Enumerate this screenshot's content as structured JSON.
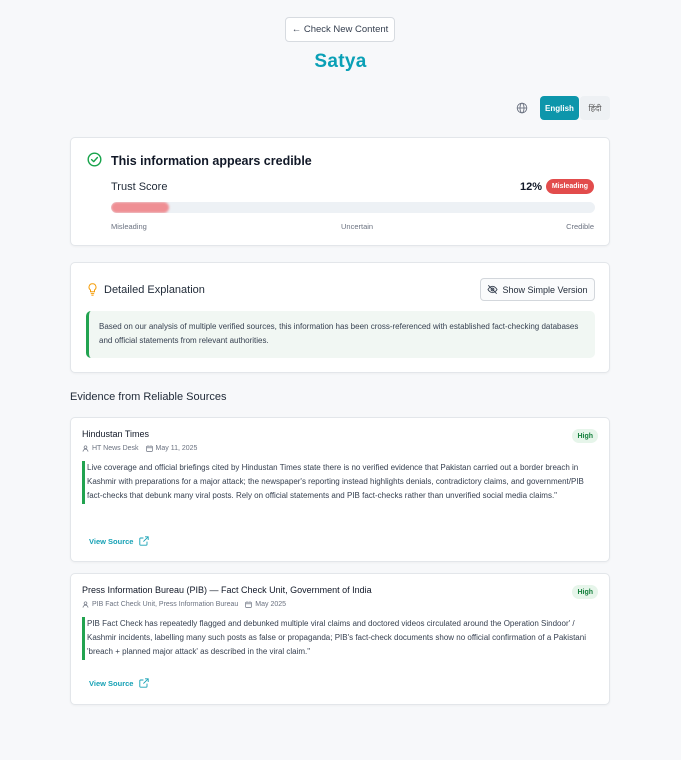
{
  "header": {
    "back_label": "← Check New Content",
    "brand": "Satya"
  },
  "language": {
    "icon": "globe-icon",
    "options": [
      "English",
      "हिंदी"
    ],
    "selected": "English"
  },
  "result": {
    "icon": "check-circle-icon",
    "title": "This information appears credible",
    "trust_label": "Trust Score",
    "trust_value": "12%",
    "trust_fraction": 0.12,
    "badge": "Misleading",
    "scale": [
      "Misleading",
      "Uncertain",
      "Credible"
    ]
  },
  "explanation": {
    "icon": "lightbulb-icon",
    "title": "Detailed Explanation",
    "toggle_label": "Show Simple Version",
    "text": "Based on our analysis of multiple verified sources, this information has been cross-referenced with established fact-checking databases and official statements from relevant authorities."
  },
  "evidence": {
    "title": "Evidence from Reliable Sources",
    "sources": [
      {
        "name": "Hindustan Times",
        "author": "HT News Desk",
        "date": "May 11, 2025",
        "reliability": "High",
        "quote": "Live coverage and official briefings cited by Hindustan Times state there is no verified evidence that Pakistan carried out a border breach in Kashmir with preparations for a major attack; the newspaper's reporting instead highlights denials, contradictory claims, and government/PIB fact-checks that debunk many viral posts. Rely on official statements and PIB fact-checks rather than unverified social media claims.\"",
        "link_label": "View Source"
      },
      {
        "name": "Press Information Bureau (PIB) — Fact Check Unit, Government of India",
        "author": "PIB Fact Check Unit, Press Information Bureau",
        "date": "May 2025",
        "reliability": "High",
        "quote": "PIB Fact Check has repeatedly flagged and debunked multiple viral claims and doctored videos circulated around the Operation Sindoor' / Kashmir incidents, labelling many such posts as false or propaganda; PIB's fact-check documents show no official confirmation of a Pakistani 'breach + planned major attack' as described in the viral claim.\"",
        "link_label": "View Source"
      }
    ]
  },
  "colors": {
    "brand": "#0aa0b6",
    "misleading": "#e24c4c",
    "high": "#15803d",
    "accent_bar": "#22a350"
  }
}
